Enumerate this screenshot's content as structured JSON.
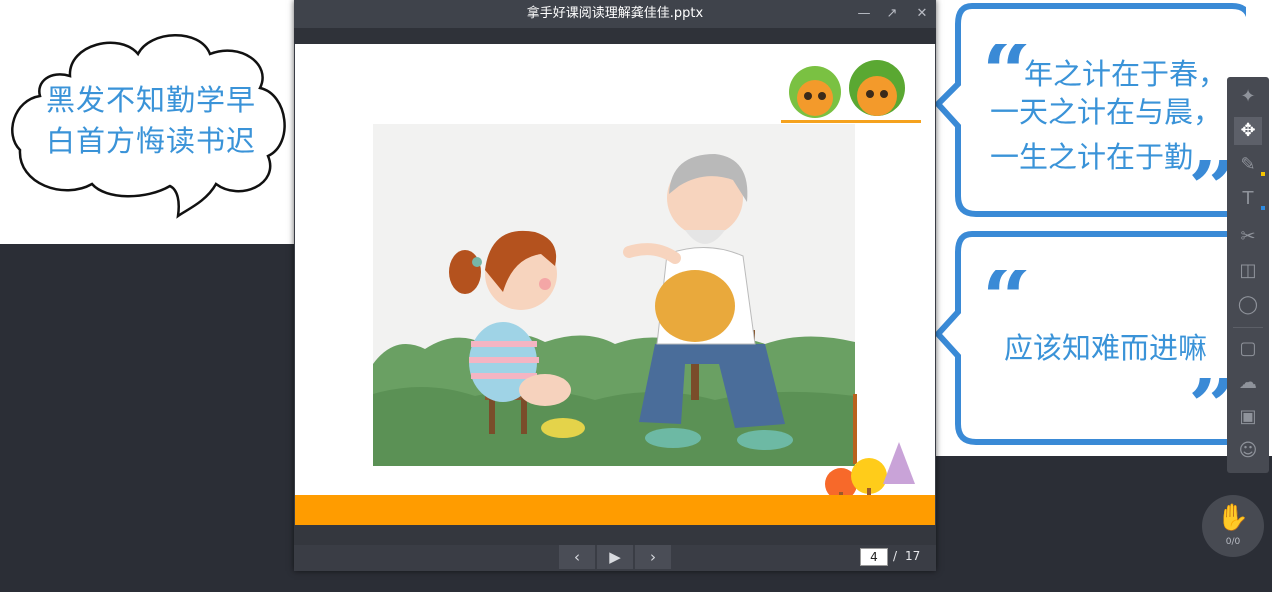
{
  "left_cloud": {
    "lines": "黑发不知勤学早\n白首方悔读书迟"
  },
  "viewer": {
    "title": "拿手好课阅读理解龚佳佳.pptx",
    "minimize_icon": "minimize-icon",
    "maximize_icon": "maximize-icon",
    "close_icon": "close-icon",
    "nav": {
      "prev_icon": "chevron-left-icon",
      "play_icon": "play-icon",
      "next_icon": "chevron-right-icon"
    },
    "page_current": "4",
    "page_separator": "/",
    "page_total": "17"
  },
  "right_bubbles": {
    "open_quote": "“",
    "close_quote": "”",
    "bubble1_lines": [
      "年之计在于春，",
      "一天之计在与晨，",
      "一生之计在于勤"
    ],
    "bubble2_line": "应该知难而进嘛"
  },
  "toolbar": {
    "tools": [
      "laser-pointer-icon",
      "select-move-icon",
      "pen-icon",
      "text-icon",
      "scissors-icon",
      "trash-icon",
      "eraser-icon",
      "chat-icon",
      "cloud-icon",
      "toolbox-icon",
      "group-icon"
    ],
    "colors": {
      "yellow": "#f5c400",
      "blue": "#2f8be0"
    }
  },
  "hand_raise": {
    "icon": "hand-icon",
    "count": "0/0"
  },
  "colors": {
    "background": "#2b2e36",
    "accent_blue": "#3a93d8",
    "slide_band": "#ff9c00"
  }
}
